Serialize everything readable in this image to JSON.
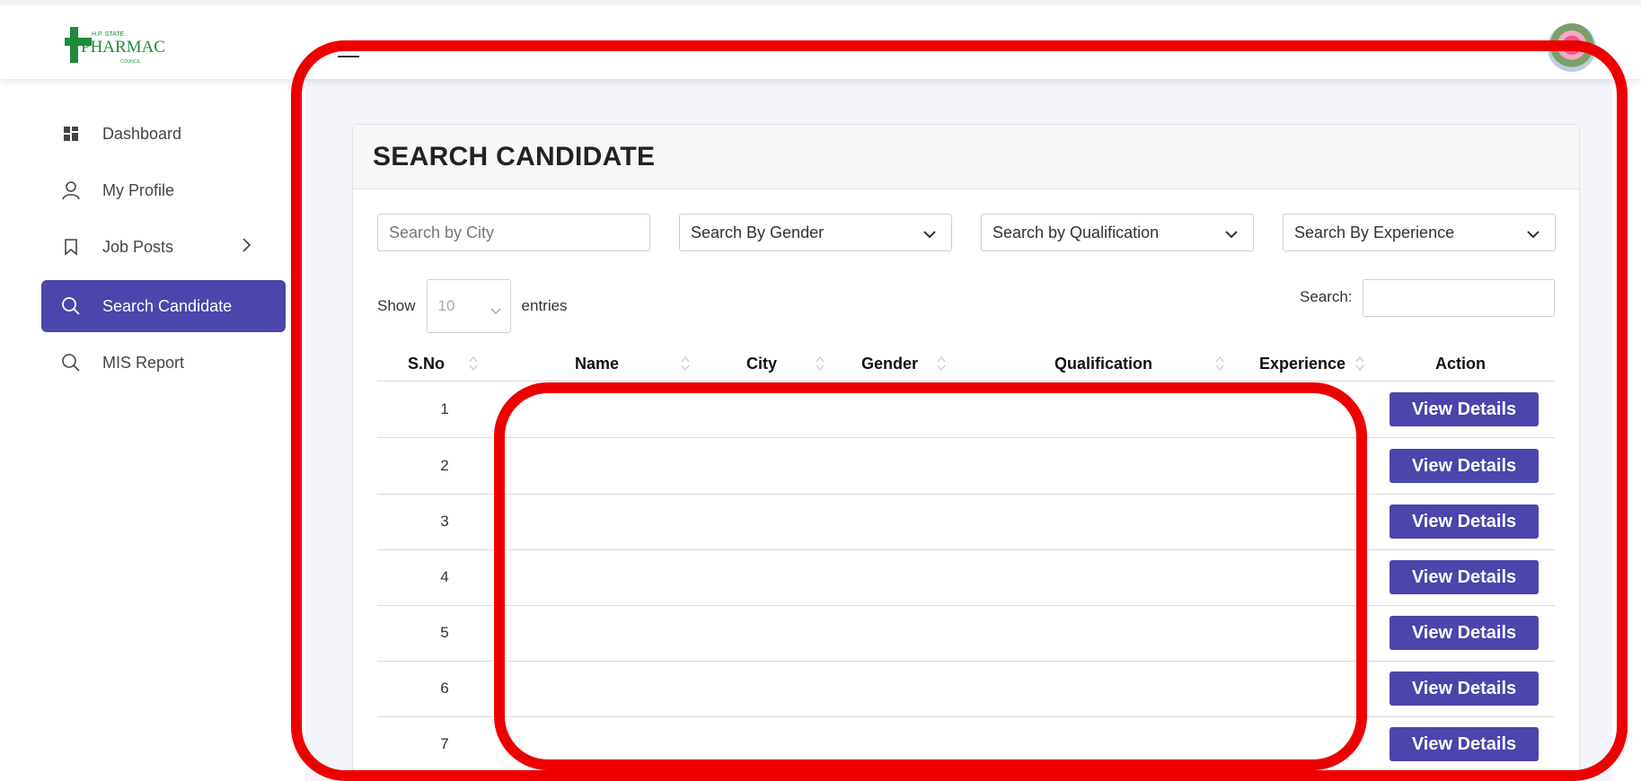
{
  "brand": {
    "logo_name": "HP State Pharmacy Council"
  },
  "sidebar": {
    "items": [
      {
        "label": "Dashboard",
        "icon": "dashboard-icon"
      },
      {
        "label": "My Profile",
        "icon": "user-icon"
      },
      {
        "label": "Job Posts",
        "icon": "bookmark-icon"
      },
      {
        "label": "Search Candidate",
        "icon": "search-icon",
        "active": true
      },
      {
        "label": "MIS Report",
        "icon": "search-icon"
      }
    ]
  },
  "page": {
    "title": "SEARCH CANDIDATE"
  },
  "filters": {
    "city_placeholder": "Search by City",
    "gender": "Search By Gender",
    "qualification": "Search by Qualification",
    "experience": "Search By Experience"
  },
  "table_controls": {
    "show_label": "Show",
    "page_length": "10",
    "entries_label": "entries",
    "search_label": "Search:"
  },
  "table": {
    "headers": [
      "S.No",
      "Name",
      "City",
      "Gender",
      "Qualification",
      "Experience",
      "Action"
    ],
    "rows": [
      {
        "sno": "1",
        "action": "View Details"
      },
      {
        "sno": "2",
        "action": "View Details"
      },
      {
        "sno": "3",
        "action": "View Details"
      },
      {
        "sno": "4",
        "action": "View Details"
      },
      {
        "sno": "5",
        "action": "View Details"
      },
      {
        "sno": "6",
        "action": "View Details"
      },
      {
        "sno": "7",
        "action": "View Details"
      }
    ]
  },
  "colors": {
    "accent": "#4b45ac",
    "highlight": "#ee0000",
    "logo_green": "#1f8a3a"
  }
}
